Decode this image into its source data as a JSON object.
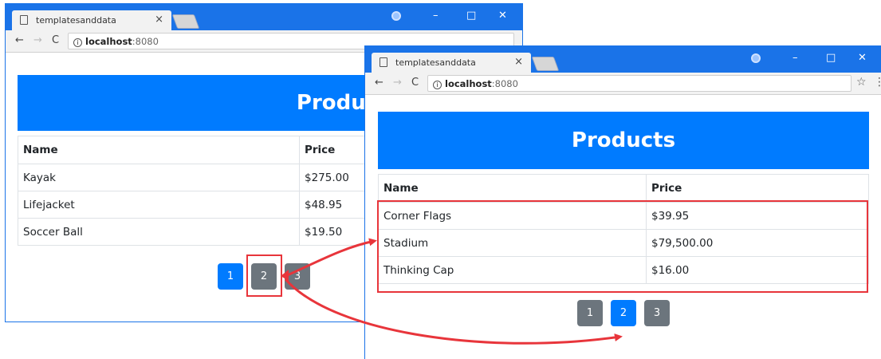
{
  "browser": {
    "tab_title": "templatesanddata",
    "tab_close": "×",
    "url_host": "localhost",
    "url_port": ":8080",
    "info_icon": "i",
    "back": "←",
    "forward": "→",
    "reload": "C",
    "star": "☆",
    "menu": "⋮",
    "minimize": "–",
    "maximize": "□",
    "close": "✕"
  },
  "page1": {
    "heading": "Products",
    "columns": [
      "Name",
      "Price"
    ],
    "rows": [
      {
        "name": "Kayak",
        "price": "$275.00"
      },
      {
        "name": "Lifejacket",
        "price": "$48.95"
      },
      {
        "name": "Soccer Ball",
        "price": "$19.50"
      }
    ],
    "pages": [
      "1",
      "2",
      "3"
    ],
    "active_page": "1"
  },
  "page2": {
    "heading": "Products",
    "columns": [
      "Name",
      "Price"
    ],
    "rows": [
      {
        "name": "Corner Flags",
        "price": "$39.95"
      },
      {
        "name": "Stadium",
        "price": "$79,500.00"
      },
      {
        "name": "Thinking Cap",
        "price": "$16.00"
      }
    ],
    "pages": [
      "1",
      "2",
      "3"
    ],
    "active_page": "2"
  },
  "colors": {
    "chrome_blue": "#1a73e8",
    "primary": "#007bff",
    "secondary": "#6c757d",
    "annotation_red": "#e8353b"
  }
}
